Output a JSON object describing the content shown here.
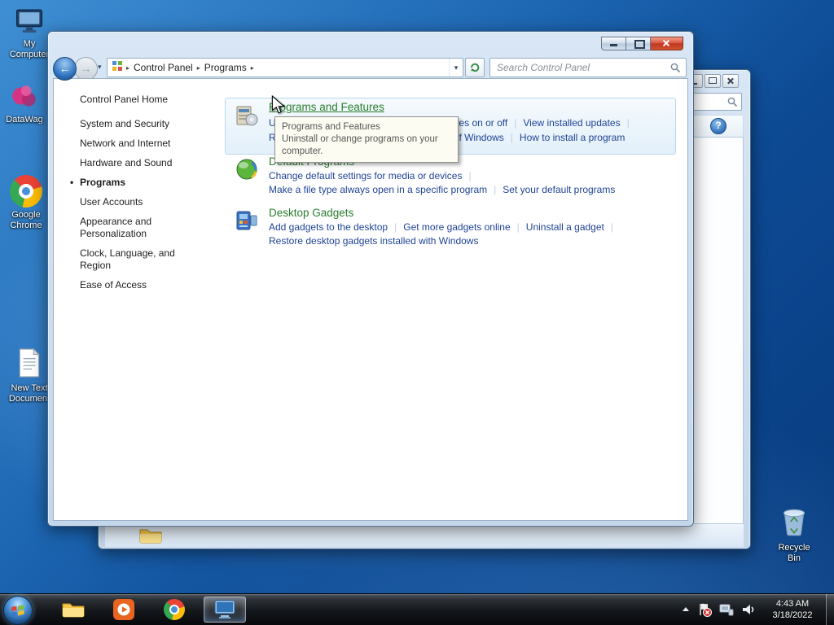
{
  "desktop": {
    "icons": [
      {
        "label": "My Computer"
      },
      {
        "label": "DataWag"
      },
      {
        "label": "Google Chrome"
      },
      {
        "label": "New Text Document"
      },
      {
        "label": "Recycle Bin"
      }
    ]
  },
  "cp": {
    "breadcrumb": {
      "root": "Control Panel",
      "page": "Programs"
    },
    "search": {
      "placeholder": "Search Control Panel"
    },
    "sidebar": {
      "home": "Control Panel Home",
      "items": [
        "System and Security",
        "Network and Internet",
        "Hardware and Sound",
        "Programs",
        "User Accounts",
        "Appearance and Personalization",
        "Clock, Language, and Region",
        "Ease of Access"
      ]
    },
    "sections": [
      {
        "title": "Programs and Features",
        "rows": [
          [
            "Uninstall a program",
            "Turn Windows features on or off",
            "View installed updates"
          ],
          [
            "Run programs made for previous versions of Windows",
            "How to install a program"
          ]
        ]
      },
      {
        "title": "Default Programs",
        "rows": [
          [
            "Change default settings for media or devices"
          ],
          [
            "Make a file type always open in a specific program",
            "Set your default programs"
          ]
        ]
      },
      {
        "title": "Desktop Gadgets",
        "rows": [
          [
            "Add gadgets to the desktop",
            "Get more gadgets online",
            "Uninstall a gadget"
          ],
          [
            "Restore desktop gadgets installed with Windows"
          ]
        ]
      }
    ]
  },
  "tooltip": {
    "title": "Programs and Features",
    "body": "Uninstall or change programs on your computer."
  },
  "taskbar": {
    "time": "4:43 AM",
    "date": "3/18/2022"
  },
  "colors": {
    "category_green": "#2a7d2e",
    "task_blue": "#1f4396",
    "close_red": "#c03821"
  }
}
